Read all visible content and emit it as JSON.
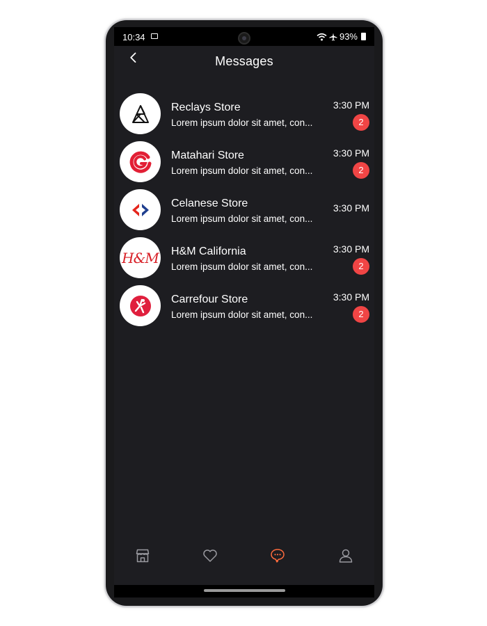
{
  "status_bar": {
    "time": "10:34",
    "battery": "93%",
    "icons": [
      "image-icon",
      "wifi-icon",
      "airplane-icon",
      "battery-icon"
    ]
  },
  "header": {
    "title": "Messages",
    "back_icon": "chevron-left-icon"
  },
  "conversations": [
    {
      "name": "Reclays Store",
      "preview": "Lorem ipsum dolor sit amet, con...",
      "time": "3:30 PM",
      "unread": "2",
      "logo": "reclays-logo"
    },
    {
      "name": "Matahari Store",
      "preview": "Lorem ipsum dolor sit amet, con...",
      "time": "3:30 PM",
      "unread": "2",
      "logo": "matahari-logo"
    },
    {
      "name": "Celanese Store",
      "preview": "Lorem ipsum dolor sit amet, con...",
      "time": "3:30 PM",
      "unread": "",
      "logo": "celanese-logo"
    },
    {
      "name": "H&M California",
      "preview": "Lorem ipsum dolor sit amet, con...",
      "time": "3:30 PM",
      "unread": "2",
      "logo": "hm-logo",
      "logo_text": "H&M"
    },
    {
      "name": "Carrefour Store",
      "preview": "Lorem ipsum dolor sit amet, con...",
      "time": "3:30 PM",
      "unread": "2",
      "logo": "carrefour-logo"
    }
  ],
  "bottom_nav": {
    "items": [
      "store-icon",
      "heart-icon",
      "chat-icon",
      "profile-icon"
    ],
    "active": "chat-icon"
  },
  "colors": {
    "background": "#1d1d21",
    "badge": "#f04545",
    "accent": "#ff6b3d",
    "text": "#ffffff"
  }
}
